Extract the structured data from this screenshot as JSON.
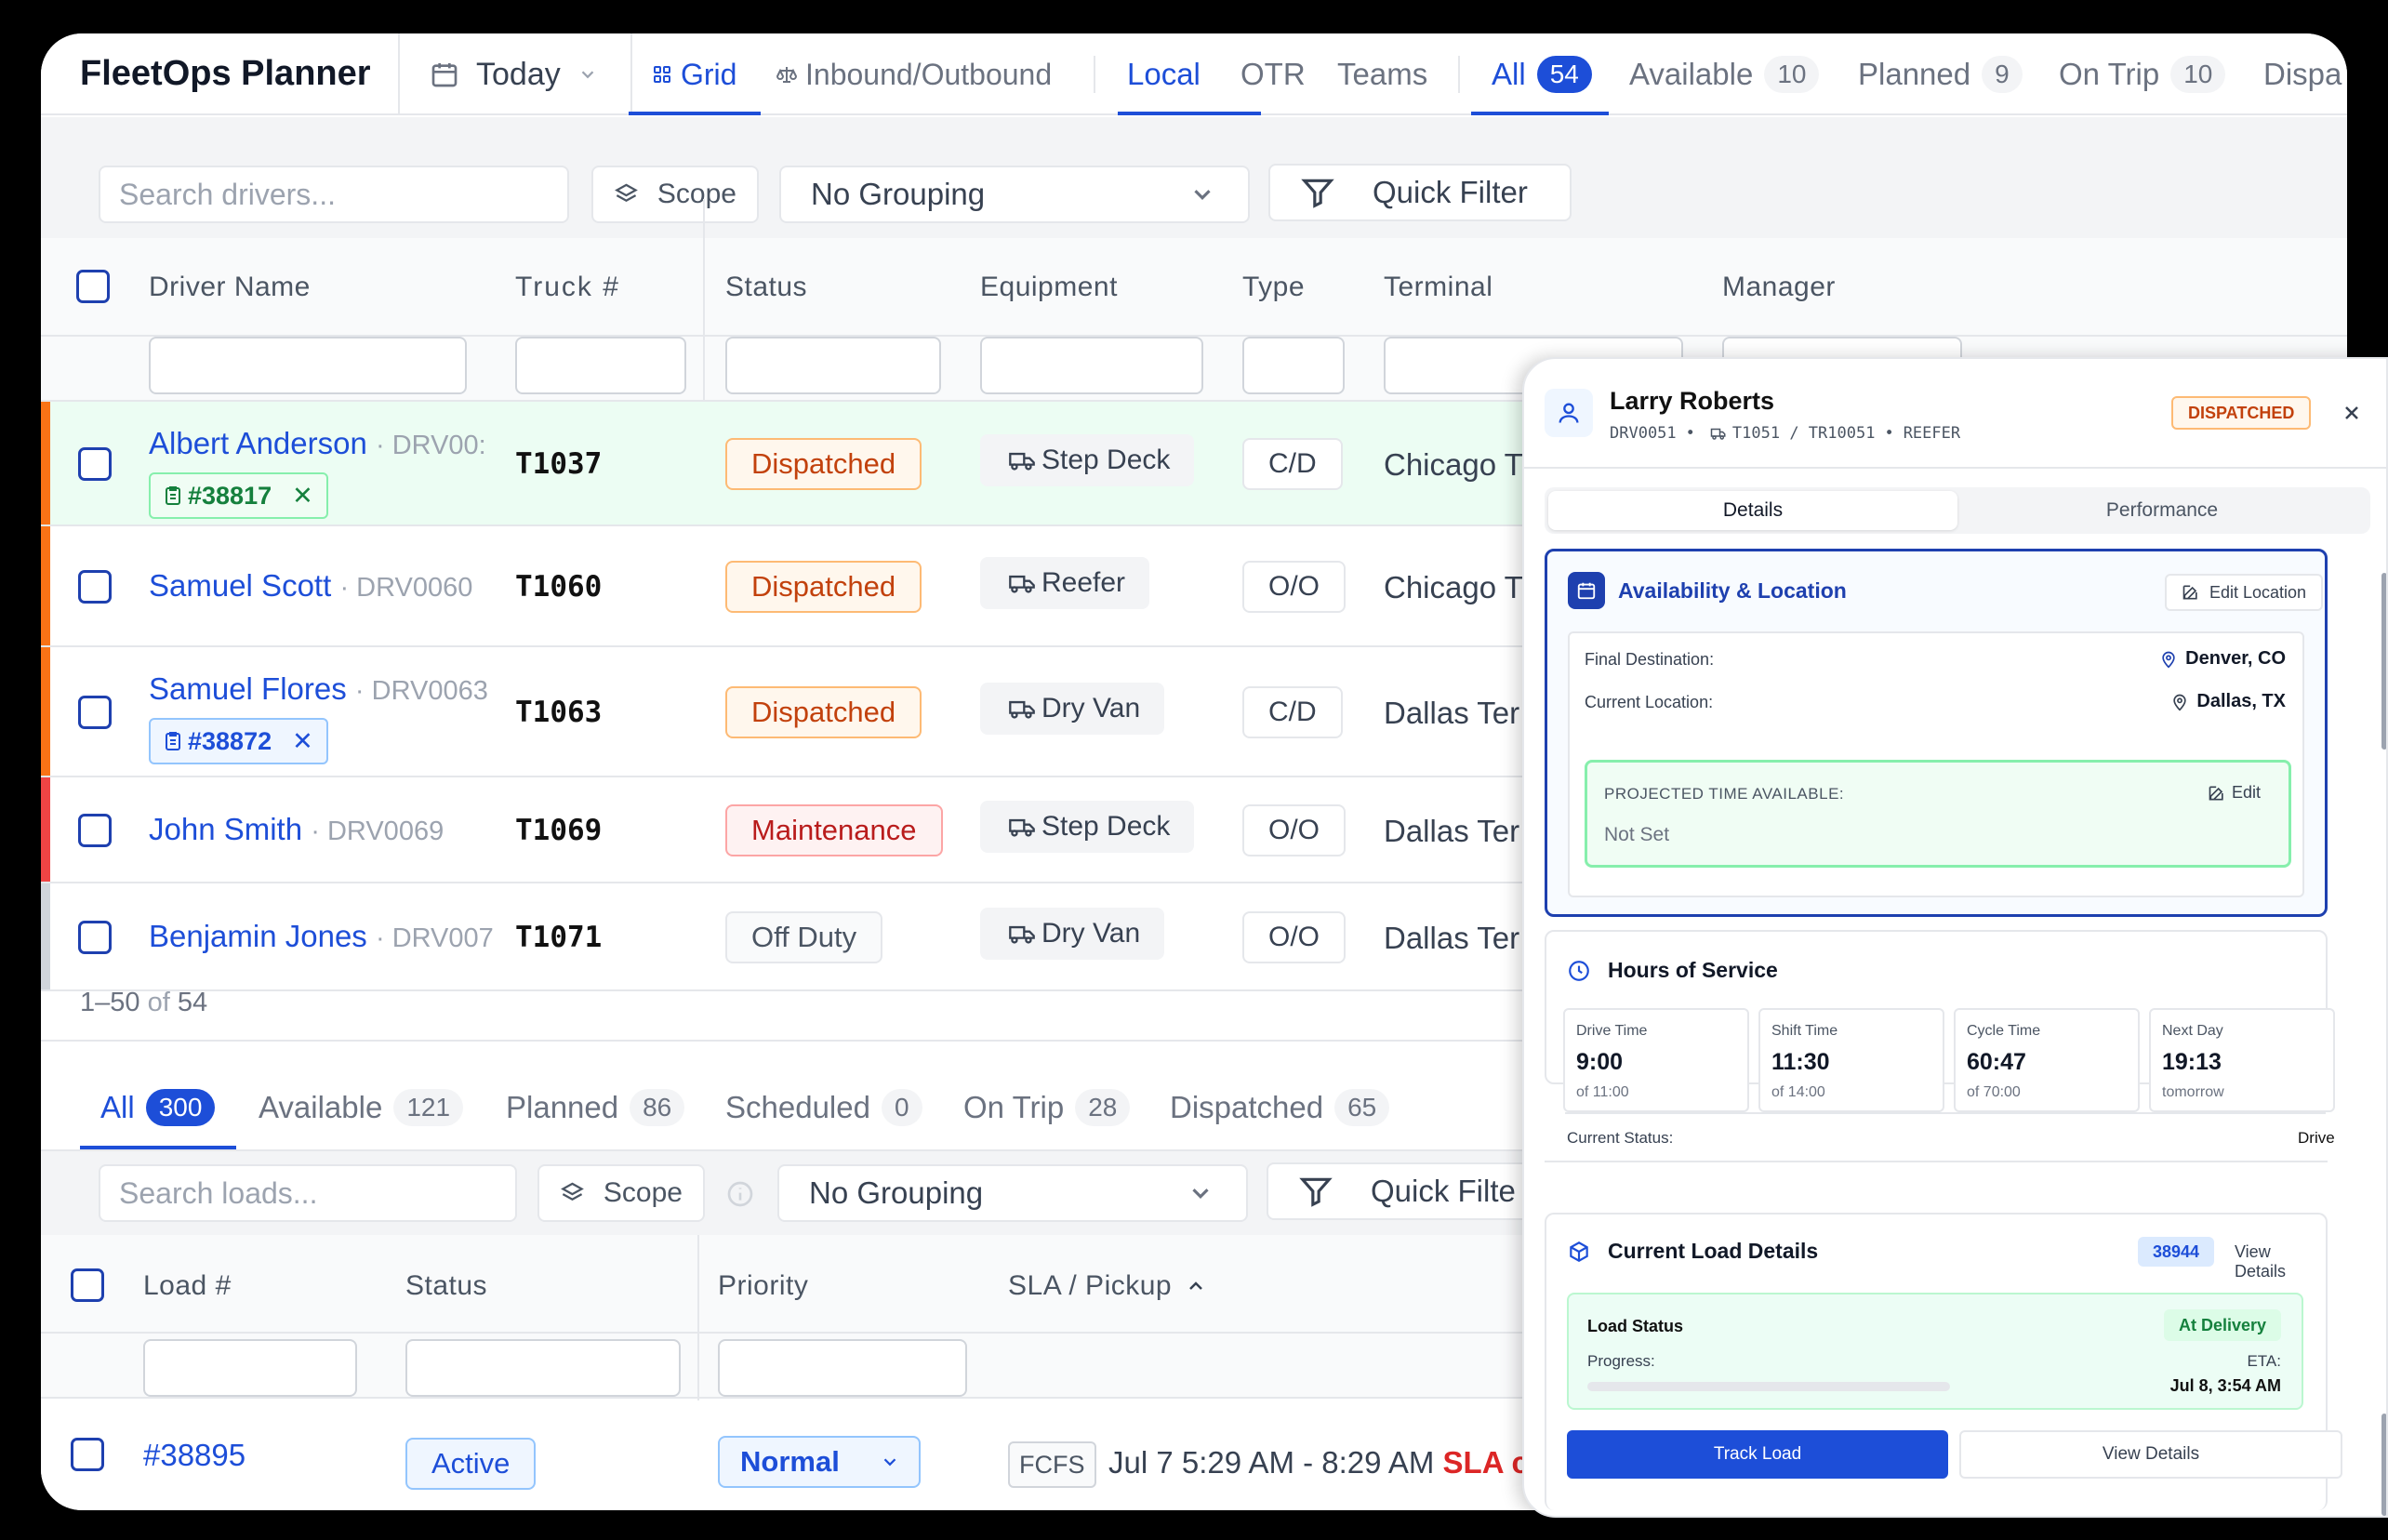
{
  "app": {
    "title": "FleetOps Planner"
  },
  "date_picker": {
    "label": "Today"
  },
  "view_tabs": [
    {
      "label": "Grid",
      "active": true
    },
    {
      "label": "Inbound/Outbound",
      "active": false
    }
  ],
  "mode_tabs": [
    {
      "label": "Local",
      "active": true
    },
    {
      "label": "OTR",
      "active": false
    },
    {
      "label": "Teams",
      "active": false
    }
  ],
  "filter_tabs": [
    {
      "label": "All",
      "count": "54",
      "active": true
    },
    {
      "label": "Available",
      "count": "10"
    },
    {
      "label": "Planned",
      "count": "9"
    },
    {
      "label": "On Trip",
      "count": "10"
    },
    {
      "label": "Dispa"
    }
  ],
  "driver_toolbar": {
    "search_placeholder": "Search drivers...",
    "scope_label": "Scope",
    "grouping_label": "No Grouping",
    "quick_filter_label": "Quick Filter"
  },
  "driver_columns": {
    "name": "Driver Name",
    "truck": "Truck #",
    "status": "Status",
    "equipment": "Equipment",
    "type": "Type",
    "terminal": "Terminal",
    "manager": "Manager"
  },
  "drivers": [
    {
      "name": "Albert Anderson",
      "id": "· DRV00:",
      "load_tag": "#38817",
      "truck": "T1037",
      "status": "Dispatched",
      "equipment": "Step Deck",
      "type": "C/D",
      "terminal": "Chicago T",
      "stripe": "#f97316"
    },
    {
      "name": "Samuel Scott",
      "id": "· DRV0060",
      "truck": "T1060",
      "status": "Dispatched",
      "equipment": "Reefer",
      "type": "O/O",
      "terminal": "Chicago T",
      "stripe": "#f97316"
    },
    {
      "name": "Samuel Flores",
      "id": "· DRV0063",
      "load_tag": "#38872",
      "truck": "T1063",
      "status": "Dispatched",
      "equipment": "Dry Van",
      "type": "C/D",
      "terminal": "Dallas Ter",
      "stripe": "#f97316"
    },
    {
      "name": "John Smith",
      "id": "· DRV0069",
      "truck": "T1069",
      "status": "Maintenance",
      "equipment": "Step Deck",
      "type": "O/O",
      "terminal": "Dallas Ter",
      "stripe": "#ef4444"
    },
    {
      "name": "Benjamin Jones",
      "id": "· DRV007",
      "truck": "T1071",
      "status": "Off Duty",
      "equipment": "Dry Van",
      "type": "O/O",
      "terminal": "Dallas Ter",
      "stripe": "#d1d5db"
    }
  ],
  "driver_pager": {
    "range": "1–50",
    "of": "of",
    "total": "54"
  },
  "load_tabs": [
    {
      "label": "All",
      "count": "300",
      "active": true
    },
    {
      "label": "Available",
      "count": "121"
    },
    {
      "label": "Planned",
      "count": "86"
    },
    {
      "label": "Scheduled",
      "count": "0"
    },
    {
      "label": "On Trip",
      "count": "28"
    },
    {
      "label": "Dispatched",
      "count": "65"
    }
  ],
  "load_toolbar": {
    "search_placeholder": "Search loads...",
    "scope_label": "Scope",
    "grouping_label": "No Grouping",
    "quick_filter_label": "Quick Filte"
  },
  "load_columns": {
    "load": "Load #",
    "status": "Status",
    "priority": "Priority",
    "sla": "SLA / Pickup"
  },
  "loads": [
    {
      "load": "#38895",
      "status": "Active",
      "priority": "Normal",
      "fcfs": "FCFS",
      "window": "Jul 7 5:29 AM - 8:29 AM",
      "sla_flag": "SLA c"
    }
  ],
  "panel": {
    "driver_name": "Larry Roberts",
    "driver_id": "DRV0051",
    "truck_trailer": "T1051 / TR10051",
    "equipment": "REEFER",
    "status_badge": "DISPATCHED",
    "tabs": [
      {
        "label": "Details",
        "active": true
      },
      {
        "label": "Performance",
        "active": false
      }
    ],
    "availability": {
      "title": "Availability & Location",
      "edit_label": "Edit Location",
      "final_destination_label": "Final Destination:",
      "final_destination": "Denver, CO",
      "current_location_label": "Current Location:",
      "current_location": "Dallas, TX",
      "projected_label": "PROJECTED TIME AVAILABLE:",
      "projected_value": "Not Set",
      "projected_edit": "Edit"
    },
    "hos": {
      "title": "Hours of Service",
      "items": [
        {
          "label": "Drive Time",
          "value": "9:00",
          "sub": "of 11:00"
        },
        {
          "label": "Shift Time",
          "value": "11:30",
          "sub": "of 14:00"
        },
        {
          "label": "Cycle Time",
          "value": "60:47",
          "sub": "of 70:00"
        },
        {
          "label": "Next Day",
          "value": "19:13",
          "sub": "tomorrow"
        }
      ],
      "current_status_label": "Current Status:",
      "current_status": "Drive"
    },
    "current_load": {
      "title": "Current Load Details",
      "load_id": "38944",
      "view_details": "View Details",
      "load_status_label": "Load Status",
      "load_status": "At Delivery",
      "progress_label": "Progress:",
      "progress": 0,
      "eta_label": "ETA:",
      "eta": "Jul 8, 3:54 AM",
      "track_button": "Track Load",
      "view_button": "View Details"
    }
  },
  "colors": {
    "accent": "#1d4ed8",
    "dispatched": "#c2410c",
    "maintenance": "#b91c1c",
    "success": "#15803d"
  }
}
